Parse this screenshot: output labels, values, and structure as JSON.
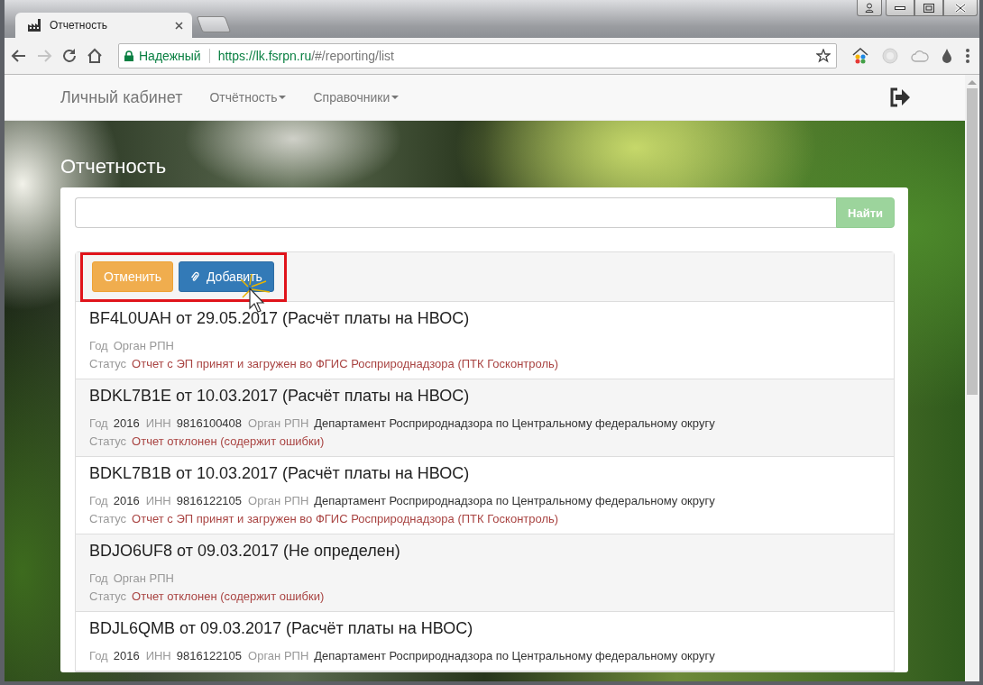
{
  "browser": {
    "tabs": [
      {
        "title": "Отчетность",
        "selected": true
      }
    ],
    "address": {
      "security_label": "Надежный",
      "url_host": "https://lk.fsrpn.ru",
      "url_path": "/#/reporting/list"
    }
  },
  "navbar": {
    "brand": "Личный кабинет",
    "menus": [
      {
        "label": "Отчётность"
      },
      {
        "label": "Справочники"
      }
    ]
  },
  "page_title": "Отчетность",
  "search": {
    "button": "Найти",
    "disabled": true
  },
  "actions": [
    {
      "label": "Отменить",
      "kind": "warning"
    },
    {
      "label": "Добавить",
      "kind": "primary"
    }
  ],
  "reports": [
    {
      "title": "BF4L0UAH от 29.05.2017 (Расчёт платы на НВОС)",
      "fields": [
        {
          "label": "Год"
        },
        {
          "label": "Орган РПН"
        }
      ],
      "status_label": "Статус",
      "status": "Отчет с ЭП принят и загружен во ФГИС Росприроднадзора (ПТК Госконтроль)"
    },
    {
      "title": "BDKL7B1E от 10.03.2017 (Расчёт платы на НВОС)",
      "fields": [
        {
          "label": "Год",
          "value": "2016"
        },
        {
          "label": "ИНН",
          "value": "9816100408"
        },
        {
          "label": "Орган РПН",
          "value": "Департамент Росприроднадзора по Центральному федеральному округу"
        }
      ],
      "status_label": "Статус",
      "status": "Отчет отклонен (содержит ошибки)"
    },
    {
      "title": "BDKL7B1B от 10.03.2017 (Расчёт платы на НВОС)",
      "fields": [
        {
          "label": "Год",
          "value": "2016"
        },
        {
          "label": "ИНН",
          "value": "9816122105"
        },
        {
          "label": "Орган РПН",
          "value": "Департамент Росприроднадзора по Центральному федеральному округу"
        }
      ],
      "status_label": "Статус",
      "status": "Отчет с ЭП принят и загружен во ФГИС Росприроднадзора (ПТК Госконтроль)"
    },
    {
      "title": "BDJO6UF8 от 09.03.2017 (Не определен)",
      "fields": [
        {
          "label": "Год"
        },
        {
          "label": "Орган РПН"
        }
      ],
      "status_label": "Статус",
      "status": "Отчет отклонен (содержит ошибки)"
    },
    {
      "title": "BDJL6QMB от 09.03.2017 (Расчёт платы на НВОС)",
      "fields": [
        {
          "label": "Год",
          "value": "2016"
        },
        {
          "label": "ИНН",
          "value": "9816122105"
        },
        {
          "label": "Орган РПН",
          "value": "Департамент Росприроднадзора по Центральному федеральному округу"
        }
      ]
    }
  ]
}
